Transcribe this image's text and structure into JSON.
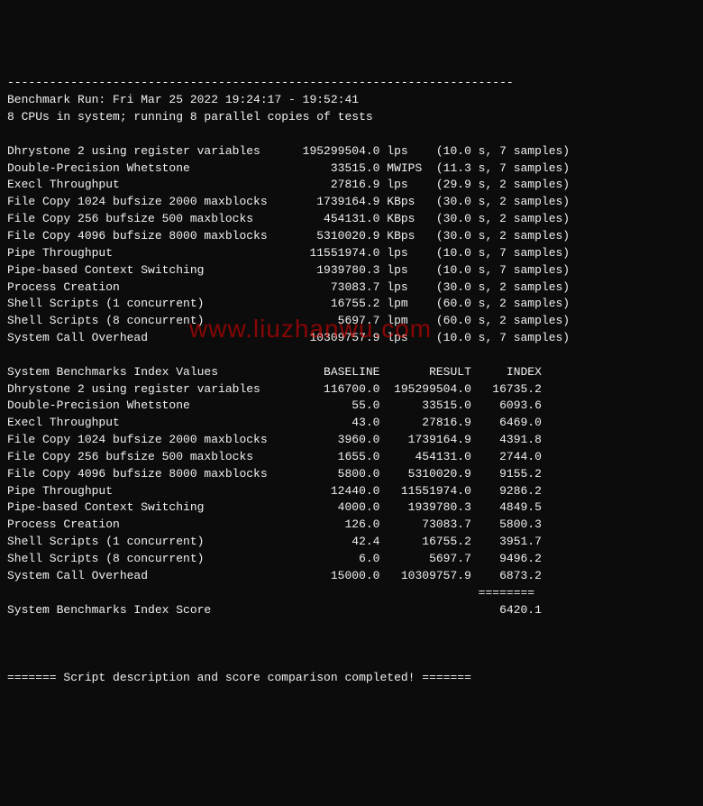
{
  "header": {
    "divider_top": "------------------------------------------------------------------------",
    "run_line": "Benchmark Run: Fri Mar 25 2022 19:24:17 - 19:52:41",
    "cpu_line": "8 CPUs in system; running 8 parallel copies of tests"
  },
  "results": [
    {
      "name": "Dhrystone 2 using register variables",
      "value": "195299504.0",
      "unit": "lps",
      "timing": "(10.0 s, 7 samples)"
    },
    {
      "name": "Double-Precision Whetstone",
      "value": "33515.0",
      "unit": "MWIPS",
      "timing": "(11.3 s, 7 samples)"
    },
    {
      "name": "Execl Throughput",
      "value": "27816.9",
      "unit": "lps",
      "timing": "(29.9 s, 2 samples)"
    },
    {
      "name": "File Copy 1024 bufsize 2000 maxblocks",
      "value": "1739164.9",
      "unit": "KBps",
      "timing": "(30.0 s, 2 samples)"
    },
    {
      "name": "File Copy 256 bufsize 500 maxblocks",
      "value": "454131.0",
      "unit": "KBps",
      "timing": "(30.0 s, 2 samples)"
    },
    {
      "name": "File Copy 4096 bufsize 8000 maxblocks",
      "value": "5310020.9",
      "unit": "KBps",
      "timing": "(30.0 s, 2 samples)"
    },
    {
      "name": "Pipe Throughput",
      "value": "11551974.0",
      "unit": "lps",
      "timing": "(10.0 s, 7 samples)"
    },
    {
      "name": "Pipe-based Context Switching",
      "value": "1939780.3",
      "unit": "lps",
      "timing": "(10.0 s, 7 samples)"
    },
    {
      "name": "Process Creation",
      "value": "73083.7",
      "unit": "lps",
      "timing": "(30.0 s, 2 samples)"
    },
    {
      "name": "Shell Scripts (1 concurrent)",
      "value": "16755.2",
      "unit": "lpm",
      "timing": "(60.0 s, 2 samples)"
    },
    {
      "name": "Shell Scripts (8 concurrent)",
      "value": "5697.7",
      "unit": "lpm",
      "timing": "(60.0 s, 2 samples)"
    },
    {
      "name": "System Call Overhead",
      "value": "10309757.9",
      "unit": "lps",
      "timing": "(10.0 s, 7 samples)"
    }
  ],
  "index_header": {
    "label": "System Benchmarks Index Values",
    "col1": "BASELINE",
    "col2": "RESULT",
    "col3": "INDEX"
  },
  "index_rows": [
    {
      "name": "Dhrystone 2 using register variables",
      "baseline": "116700.0",
      "result": "195299504.0",
      "index": "16735.2"
    },
    {
      "name": "Double-Precision Whetstone",
      "baseline": "55.0",
      "result": "33515.0",
      "index": "6093.6"
    },
    {
      "name": "Execl Throughput",
      "baseline": "43.0",
      "result": "27816.9",
      "index": "6469.0"
    },
    {
      "name": "File Copy 1024 bufsize 2000 maxblocks",
      "baseline": "3960.0",
      "result": "1739164.9",
      "index": "4391.8"
    },
    {
      "name": "File Copy 256 bufsize 500 maxblocks",
      "baseline": "1655.0",
      "result": "454131.0",
      "index": "2744.0"
    },
    {
      "name": "File Copy 4096 bufsize 8000 maxblocks",
      "baseline": "5800.0",
      "result": "5310020.9",
      "index": "9155.2"
    },
    {
      "name": "Pipe Throughput",
      "baseline": "12440.0",
      "result": "11551974.0",
      "index": "9286.2"
    },
    {
      "name": "Pipe-based Context Switching",
      "baseline": "4000.0",
      "result": "1939780.3",
      "index": "4849.5"
    },
    {
      "name": "Process Creation",
      "baseline": "126.0",
      "result": "73083.7",
      "index": "5800.3"
    },
    {
      "name": "Shell Scripts (1 concurrent)",
      "baseline": "42.4",
      "result": "16755.2",
      "index": "3951.7"
    },
    {
      "name": "Shell Scripts (8 concurrent)",
      "baseline": "6.0",
      "result": "5697.7",
      "index": "9496.2"
    },
    {
      "name": "System Call Overhead",
      "baseline": "15000.0",
      "result": "10309757.9",
      "index": "6873.2"
    }
  ],
  "score": {
    "divider": "                                                                   ========",
    "label": "System Benchmarks Index Score",
    "value": "6420.1"
  },
  "footer": {
    "line": "======= Script description and score comparison completed! ======="
  },
  "watermark": "www.liuzhanwu.com"
}
